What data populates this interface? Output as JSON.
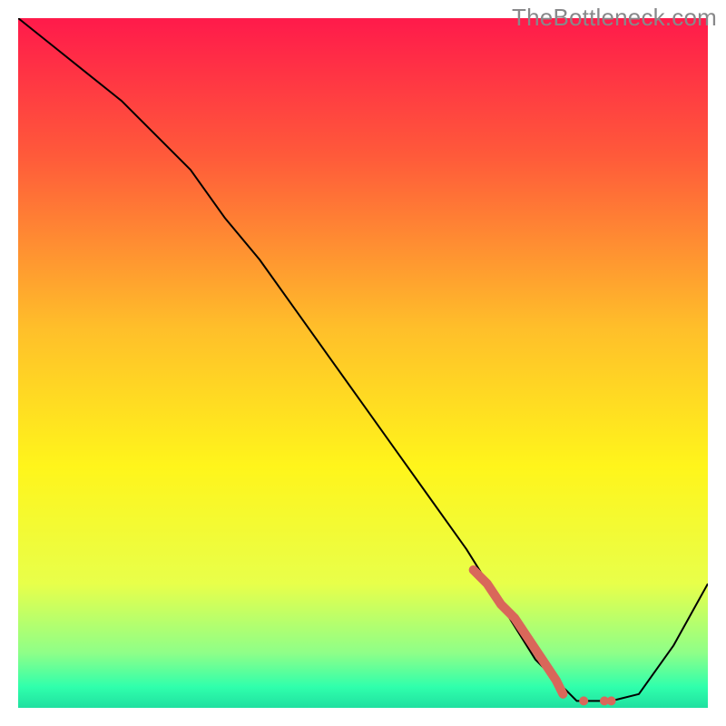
{
  "watermark": "TheBottleneck.com",
  "chart_data": {
    "type": "line",
    "title": "",
    "xlabel": "",
    "ylabel": "",
    "xlim": [
      0,
      100
    ],
    "ylim": [
      0,
      100
    ],
    "grid": false,
    "legend": false,
    "background_gradient_stops": [
      {
        "offset": 0.0,
        "color": "#ff1a4b"
      },
      {
        "offset": 0.2,
        "color": "#ff5a3a"
      },
      {
        "offset": 0.45,
        "color": "#ffbf2a"
      },
      {
        "offset": 0.65,
        "color": "#fff51b"
      },
      {
        "offset": 0.82,
        "color": "#e8ff4a"
      },
      {
        "offset": 0.92,
        "color": "#8fff88"
      },
      {
        "offset": 0.97,
        "color": "#2fffac"
      },
      {
        "offset": 1.0,
        "color": "#20e0a0"
      }
    ],
    "series": [
      {
        "name": "bottleneck-curve",
        "color": "#000000",
        "stroke_width": 2,
        "x": [
          0,
          5,
          10,
          15,
          20,
          25,
          30,
          35,
          40,
          45,
          50,
          55,
          60,
          65,
          70,
          75,
          80,
          81,
          86,
          90,
          95,
          100
        ],
        "y": [
          100,
          96,
          92,
          88,
          83,
          78,
          71,
          65,
          58,
          51,
          44,
          37,
          30,
          23,
          15,
          7,
          2,
          1,
          1,
          2,
          9,
          18
        ]
      },
      {
        "name": "highlight-segment",
        "color": "#d9675a",
        "stroke_width": 10,
        "dotted_tail": true,
        "x": [
          66,
          68,
          70,
          72,
          74,
          76,
          78,
          79,
          82,
          85,
          86
        ],
        "y": [
          20,
          18,
          15,
          13,
          10,
          7,
          4,
          2,
          1,
          1,
          1
        ]
      }
    ]
  }
}
